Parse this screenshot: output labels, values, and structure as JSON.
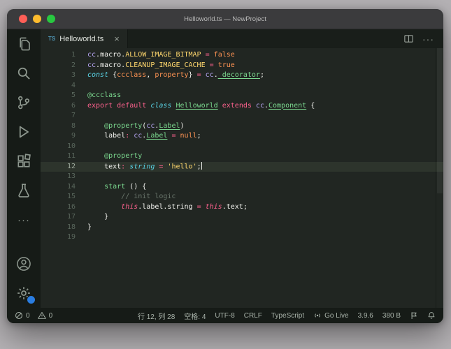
{
  "window": {
    "title": "Helloworld.ts — NewProject"
  },
  "colors": {
    "traffic_red": "#ff5f57",
    "traffic_yellow": "#febc2e",
    "traffic_green": "#28c840",
    "badge_blue": "#2a7de1",
    "ts_icon_blue": "#519aba",
    "editor_background": "#212622",
    "current_line": "#2d342c"
  },
  "tab": {
    "icon_label": "TS",
    "label": "Helloworld.ts",
    "close_glyph": "×"
  },
  "tabbar": {
    "more_glyph": "···"
  },
  "activitybar": {
    "top": [
      {
        "name": "explorer",
        "icon": "explorer"
      },
      {
        "name": "search",
        "icon": "search"
      },
      {
        "name": "source-control",
        "icon": "source-control"
      },
      {
        "name": "run-debug",
        "icon": "run-debug"
      },
      {
        "name": "extensions",
        "icon": "extensions"
      },
      {
        "name": "testing",
        "icon": "testing"
      },
      {
        "name": "more-views",
        "icon": "more",
        "glyph": "···"
      }
    ],
    "bottom": [
      {
        "name": "account",
        "icon": "account"
      },
      {
        "name": "settings",
        "icon": "settings",
        "badge": true
      }
    ]
  },
  "editor": {
    "active_line": 12,
    "cursor": {
      "line": 12,
      "col": 28
    },
    "lines": [
      {
        "n": 1,
        "tokens": [
          [
            "cc",
            "purple"
          ],
          [
            ".macro.",
            "fg"
          ],
          [
            "ALLOW_IMAGE_BITMAP",
            "yellow"
          ],
          [
            " ",
            "fg"
          ],
          [
            "=",
            "pink"
          ],
          [
            " ",
            "fg"
          ],
          [
            "false",
            "orange"
          ]
        ]
      },
      {
        "n": 2,
        "tokens": [
          [
            "cc",
            "purple"
          ],
          [
            ".macro.",
            "fg"
          ],
          [
            "CLEANUP_IMAGE_CACHE",
            "yellow"
          ],
          [
            " ",
            "fg"
          ],
          [
            "=",
            "pink"
          ],
          [
            " ",
            "fg"
          ],
          [
            "true",
            "orange"
          ]
        ]
      },
      {
        "n": 3,
        "tokens": [
          [
            "const",
            "cyani"
          ],
          [
            " {",
            "fg"
          ],
          [
            "ccclass",
            "orange"
          ],
          [
            ", ",
            "fg"
          ],
          [
            "property",
            "orange"
          ],
          [
            "} ",
            "fg"
          ],
          [
            "=",
            "pink"
          ],
          [
            " ",
            "fg"
          ],
          [
            "cc",
            "purple"
          ],
          [
            ".",
            "fg"
          ],
          [
            "_decorator",
            "greenu"
          ],
          [
            ";",
            "fg"
          ]
        ]
      },
      {
        "n": 4,
        "tokens": []
      },
      {
        "n": 5,
        "tokens": [
          [
            "@ccclass",
            "green"
          ]
        ]
      },
      {
        "n": 6,
        "tokens": [
          [
            "export",
            "pink"
          ],
          [
            " ",
            "fg"
          ],
          [
            "default",
            "pink"
          ],
          [
            " ",
            "fg"
          ],
          [
            "class",
            "cyani"
          ],
          [
            " ",
            "fg"
          ],
          [
            "Helloworld",
            "greenu"
          ],
          [
            " ",
            "fg"
          ],
          [
            "extends",
            "pink"
          ],
          [
            " ",
            "fg"
          ],
          [
            "cc",
            "purple"
          ],
          [
            ".",
            "fg"
          ],
          [
            "Component",
            "greenu"
          ],
          [
            " {",
            "fg"
          ]
        ]
      },
      {
        "n": 7,
        "tokens": []
      },
      {
        "n": 8,
        "tokens": [
          [
            "    ",
            "fg"
          ],
          [
            "@property",
            "green"
          ],
          [
            "(",
            "fg"
          ],
          [
            "cc",
            "purple"
          ],
          [
            ".",
            "fg"
          ],
          [
            "Label",
            "greenu"
          ],
          [
            ")",
            "fg"
          ]
        ]
      },
      {
        "n": 9,
        "tokens": [
          [
            "    label",
            "fg"
          ],
          [
            ":",
            "pink"
          ],
          [
            " ",
            "fg"
          ],
          [
            "cc",
            "purple"
          ],
          [
            ".",
            "fg"
          ],
          [
            "Label",
            "greenu"
          ],
          [
            " ",
            "fg"
          ],
          [
            "=",
            "pink"
          ],
          [
            " ",
            "fg"
          ],
          [
            "null",
            "orange"
          ],
          [
            ";",
            "fg"
          ]
        ]
      },
      {
        "n": 10,
        "tokens": []
      },
      {
        "n": 11,
        "tokens": [
          [
            "    ",
            "fg"
          ],
          [
            "@property",
            "green"
          ]
        ]
      },
      {
        "n": 12,
        "tokens": [
          [
            "    text",
            "fg"
          ],
          [
            ":",
            "pink"
          ],
          [
            " ",
            "fg"
          ],
          [
            "string",
            "cyani"
          ],
          [
            " ",
            "fg"
          ],
          [
            "=",
            "pink"
          ],
          [
            " ",
            "fg"
          ],
          [
            "'hello'",
            "yellow"
          ],
          [
            ";",
            "fg"
          ]
        ]
      },
      {
        "n": 13,
        "tokens": []
      },
      {
        "n": 14,
        "tokens": [
          [
            "    ",
            "fg"
          ],
          [
            "start",
            "green"
          ],
          [
            " () {",
            "fg"
          ]
        ]
      },
      {
        "n": 15,
        "tokens": [
          [
            "        ",
            "fg"
          ],
          [
            "// init logic",
            "comment"
          ]
        ]
      },
      {
        "n": 16,
        "tokens": [
          [
            "        ",
            "fg"
          ],
          [
            "this",
            "pinki"
          ],
          [
            ".label.string ",
            "fg"
          ],
          [
            "=",
            "pink"
          ],
          [
            " ",
            "fg"
          ],
          [
            "this",
            "pinki"
          ],
          [
            ".text;",
            "fg"
          ]
        ]
      },
      {
        "n": 17,
        "tokens": [
          [
            "    }",
            "fg"
          ]
        ]
      },
      {
        "n": 18,
        "tokens": [
          [
            "}",
            "fg"
          ]
        ]
      },
      {
        "n": 19,
        "tokens": []
      }
    ]
  },
  "statusbar": {
    "left": [
      {
        "name": "errors",
        "icon": "error",
        "text": "0"
      },
      {
        "name": "warnings",
        "icon": "warning",
        "text": "0"
      }
    ],
    "right": [
      {
        "name": "cursor-position",
        "text": "行 12, 列 28"
      },
      {
        "name": "indentation",
        "text": "空格: 4"
      },
      {
        "name": "encoding",
        "text": "UTF-8"
      },
      {
        "name": "eol",
        "text": "CRLF"
      },
      {
        "name": "language-mode",
        "text": "TypeScript"
      },
      {
        "name": "go-live",
        "icon": "golive",
        "text": "Go Live"
      },
      {
        "name": "version",
        "text": "3.9.6"
      },
      {
        "name": "file-size",
        "text": "380 B"
      },
      {
        "name": "flag",
        "icon": "flag"
      },
      {
        "name": "notifications",
        "icon": "bell"
      }
    ]
  }
}
